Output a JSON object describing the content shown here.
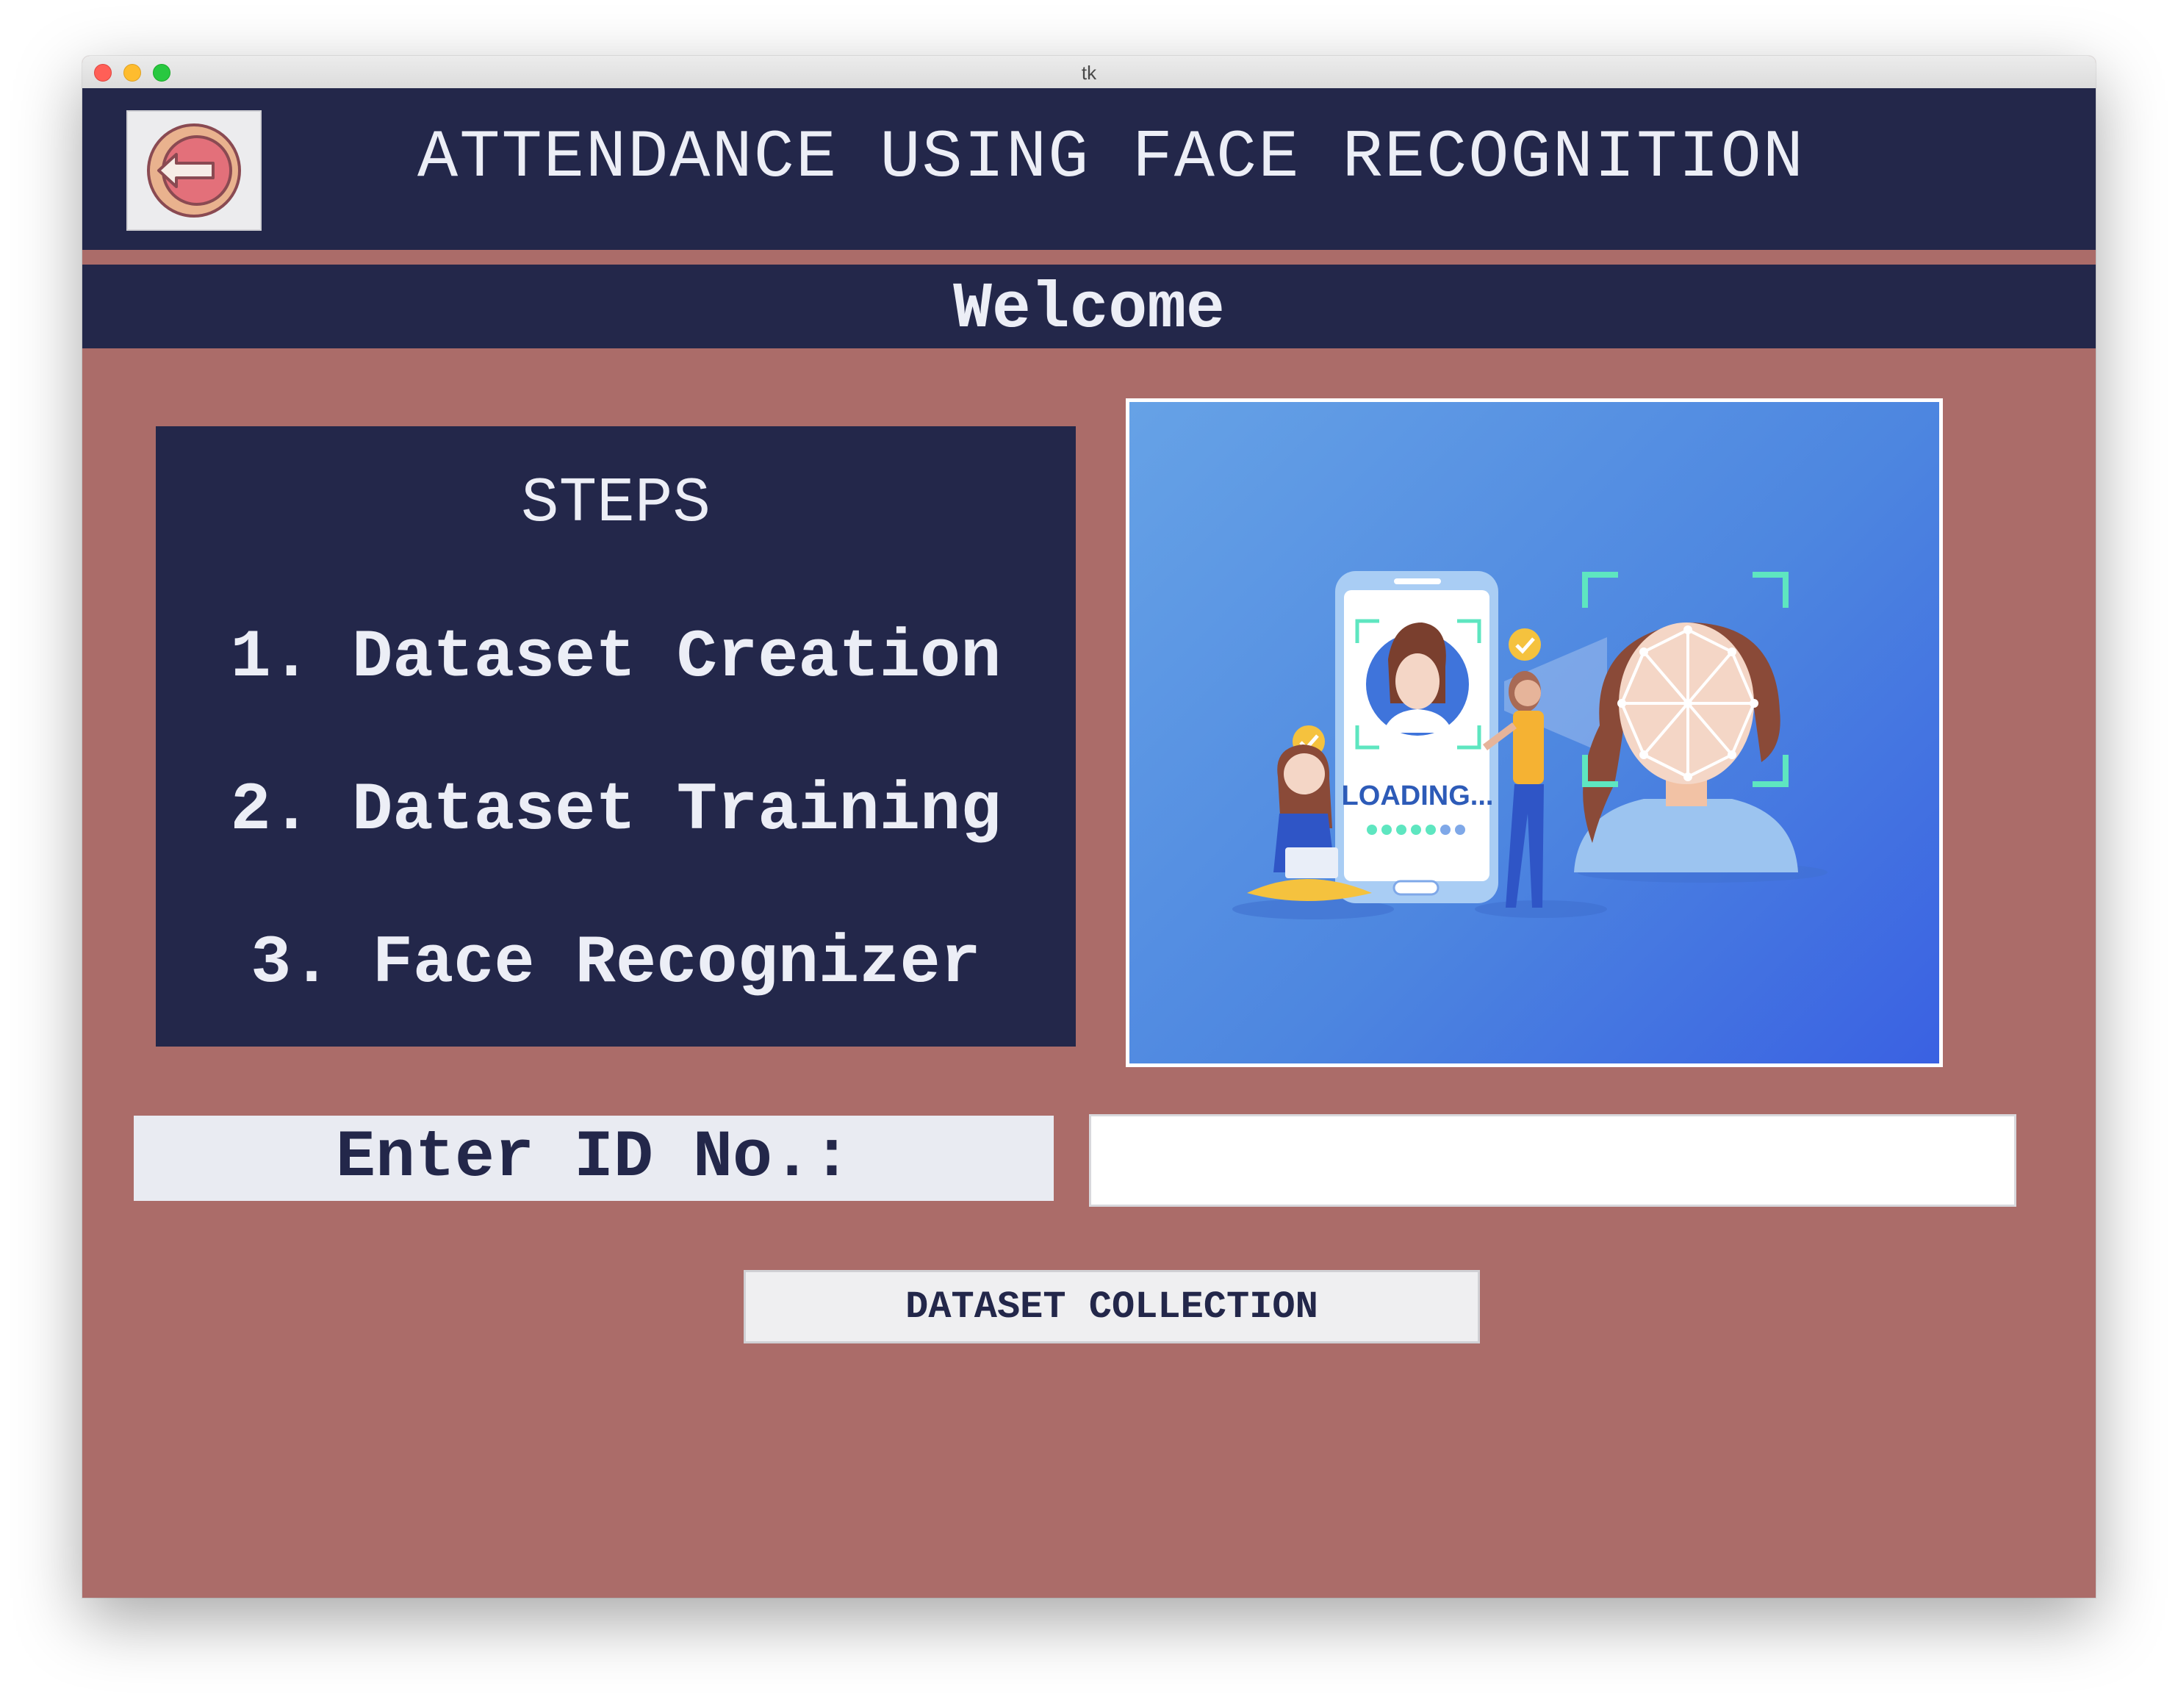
{
  "window": {
    "title": "tk"
  },
  "header": {
    "title": "ATTENDANCE USING FACE RECOGNITION",
    "back_icon": "exit-arrow-icon"
  },
  "welcome": "Welcome",
  "steps": {
    "title": "STEPS",
    "items": [
      "1. Dataset Creation",
      "2. Dataset Training",
      "3. Face Recognizer"
    ]
  },
  "illustration": {
    "loading_text": "LOADING..."
  },
  "form": {
    "id_label": "Enter ID No.:",
    "id_value": "",
    "button_label": "DATASET COLLECTION"
  },
  "colors": {
    "navy": "#23274a",
    "rose": "#ab6c69",
    "light": "#e9ebf2",
    "illustration_blue": "#4d86e0"
  }
}
